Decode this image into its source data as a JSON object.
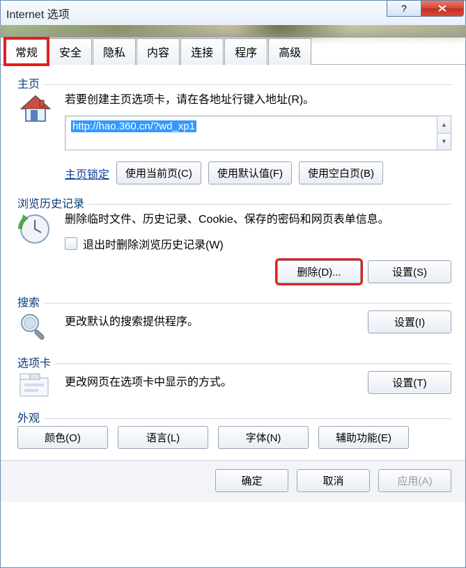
{
  "title": "Internet 选项",
  "tabs": [
    "常规",
    "安全",
    "隐私",
    "内容",
    "连接",
    "程序",
    "高级"
  ],
  "homepage": {
    "label": "主页",
    "desc": "若要创建主页选项卡，请在各地址行键入地址(R)。",
    "url": "http://hao.360.cn/?wd_xp1",
    "lock_link": "主页锁定",
    "btn_current": "使用当前页(C)",
    "btn_default": "使用默认值(F)",
    "btn_blank": "使用空白页(B)"
  },
  "history": {
    "label": "浏览历史记录",
    "desc": "删除临时文件、历史记录、Cookie、保存的密码和网页表单信息。",
    "checkbox": "退出时删除浏览历史记录(W)",
    "btn_delete": "删除(D)...",
    "btn_settings": "设置(S)"
  },
  "search": {
    "label": "搜索",
    "desc": "更改默认的搜索提供程序。",
    "btn_settings": "设置(I)"
  },
  "tabgroup": {
    "label": "选项卡",
    "desc": "更改网页在选项卡中显示的方式。",
    "btn_settings": "设置(T)"
  },
  "appearance": {
    "label": "外观",
    "btn_colors": "颜色(O)",
    "btn_lang": "语言(L)",
    "btn_fonts": "字体(N)",
    "btn_access": "辅助功能(E)"
  },
  "footer": {
    "ok": "确定",
    "cancel": "取消",
    "apply": "应用(A)"
  }
}
